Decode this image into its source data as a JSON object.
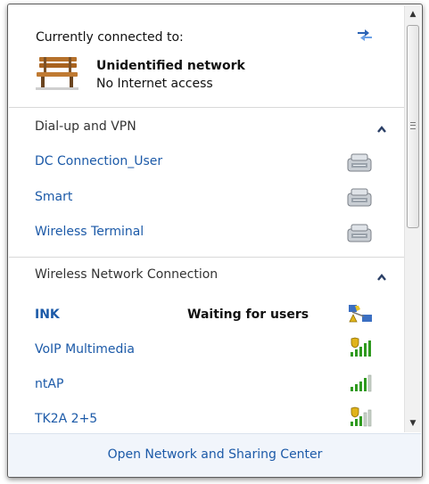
{
  "header": {
    "title": "Currently connected to:",
    "network_name": "Unidentified network",
    "network_status": "No Internet access",
    "refresh_icon": "refresh-network-icon",
    "network_icon": "park-bench-icon"
  },
  "dialup": {
    "label": "Dial-up and VPN",
    "items": [
      {
        "name": "DC Connection_User",
        "icon": "dialup-modem-icon"
      },
      {
        "name": "Smart",
        "icon": "dialup-modem-icon"
      },
      {
        "name": "Wireless Terminal",
        "icon": "dialup-modem-icon"
      }
    ]
  },
  "wireless": {
    "label": "Wireless Network Connection",
    "items": [
      {
        "name": "INK",
        "status": "Waiting for users",
        "icon": "ad-hoc-network-icon"
      },
      {
        "name": "VoIP Multimedia",
        "icon": "secured-signal-icon"
      },
      {
        "name": "ntAP",
        "icon": "signal-strength-icon"
      },
      {
        "name": "TK2A 2+5",
        "icon": "secured-signal-icon"
      }
    ]
  },
  "footer": {
    "link": "Open Network and Sharing Center"
  },
  "colors": {
    "link": "#1c5aa8",
    "footer_bg": "#f1f5fb",
    "signal_green": "#2f9a1f"
  }
}
